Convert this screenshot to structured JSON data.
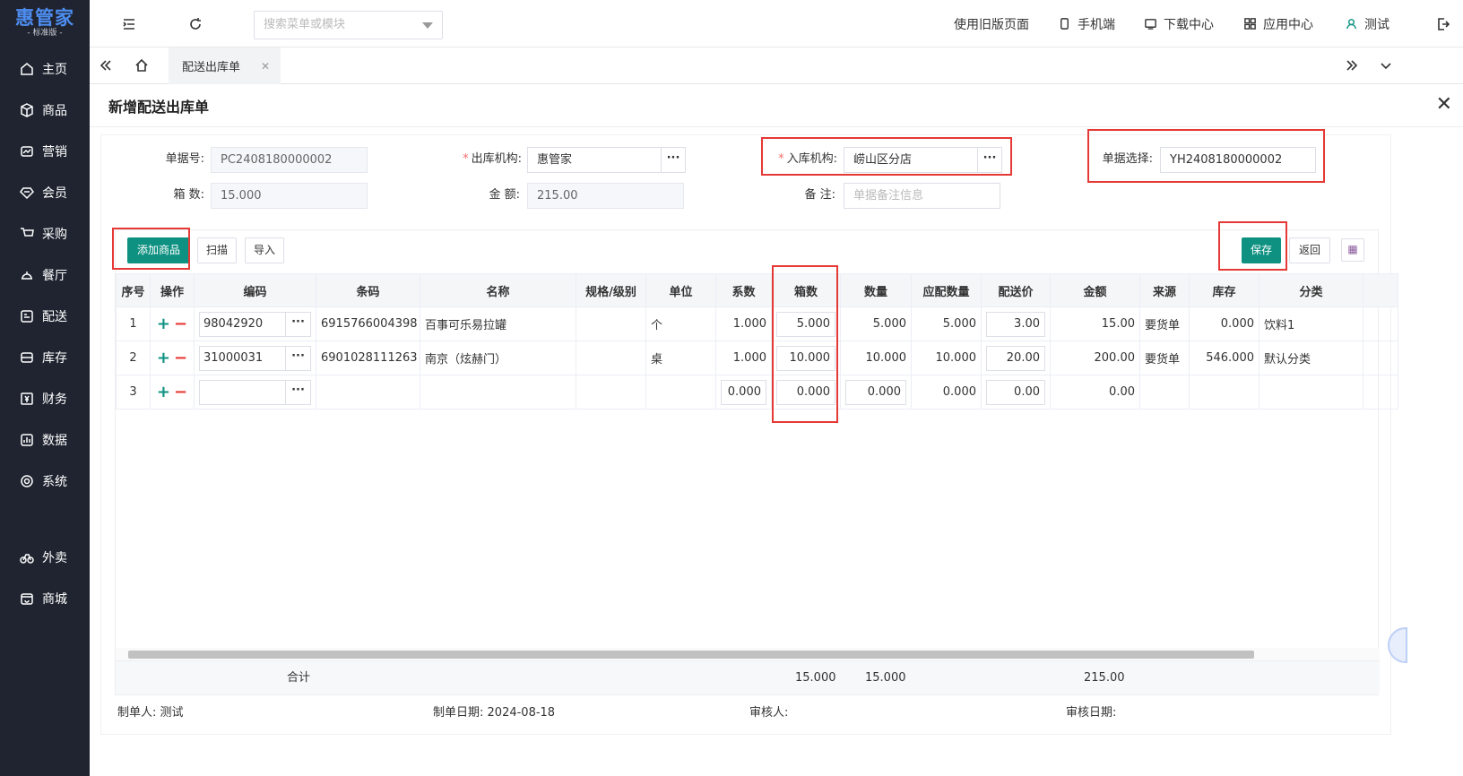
{
  "logo": {
    "brand": "惠管家",
    "edition": "- 标准版 -"
  },
  "nav": [
    {
      "label": "主页",
      "icon": "home-icon"
    },
    {
      "label": "商品",
      "icon": "box-icon"
    },
    {
      "label": "营销",
      "icon": "chart-icon"
    },
    {
      "label": "会员",
      "icon": "diamond-icon"
    },
    {
      "label": "采购",
      "icon": "cart-icon"
    },
    {
      "label": "餐厅",
      "icon": "dish-icon"
    },
    {
      "label": "配送",
      "icon": "delivery-icon"
    },
    {
      "label": "库存",
      "icon": "storage-icon"
    },
    {
      "label": "财务",
      "icon": "finance-icon"
    },
    {
      "label": "数据",
      "icon": "data-icon"
    },
    {
      "label": "系统",
      "icon": "settings-icon"
    },
    {
      "label": "外卖",
      "icon": "bike-icon"
    },
    {
      "label": "商城",
      "icon": "store-icon"
    }
  ],
  "topbar": {
    "search_placeholder": "搜索菜单或模块",
    "old_version": "使用旧版页面",
    "mobile": "手机端",
    "download": "下载中心",
    "apps": "应用中心",
    "user": "测试"
  },
  "tabs": [
    {
      "label": "配送出库单"
    }
  ],
  "panel": {
    "title": "新增配送出库单"
  },
  "form": {
    "doc_no_label": "单据号:",
    "doc_no": "PC2408180000002",
    "out_org_label": "出库机构:",
    "out_org": "惠管家",
    "in_org_label": "入库机构:",
    "in_org": "崂山区分店",
    "doc_select_label": "单据选择:",
    "doc_select": "YH2408180000002",
    "boxes_label": "箱 数:",
    "boxes": "15.000",
    "amount_label": "金 额:",
    "amount": "215.00",
    "remark_label": "备 注:",
    "remark_placeholder": "单据备注信息"
  },
  "toolbar": {
    "add": "添加商品",
    "scan": "扫描",
    "import": "导入",
    "save": "保存",
    "back": "返回"
  },
  "columns": [
    "序号",
    "操作",
    "编码",
    "条码",
    "名称",
    "规格/级别",
    "单位",
    "系数",
    "箱数",
    "数量",
    "应配数量",
    "配送价",
    "金额",
    "来源",
    "库存",
    "分类"
  ],
  "rows": [
    {
      "no": "1",
      "code": "98042920",
      "barcode": "6915766004398",
      "name": "百事可乐易拉罐",
      "spec": "",
      "unit": "个",
      "factor": "1.000",
      "boxes": "5.000",
      "qty": "5.000",
      "need": "5.000",
      "price": "3.00",
      "amount": "15.00",
      "source": "要货单",
      "stock": "0.000",
      "cat": "饮料1"
    },
    {
      "no": "2",
      "code": "31000031",
      "barcode": "6901028111263",
      "name": "南京（炫赫门）",
      "spec": "",
      "unit": "桌",
      "factor": "1.000",
      "boxes": "10.000",
      "qty": "10.000",
      "need": "10.000",
      "price": "20.00",
      "amount": "200.00",
      "source": "要货单",
      "stock": "546.000",
      "cat": "默认分类"
    },
    {
      "no": "3",
      "code": "",
      "barcode": "",
      "name": "",
      "spec": "",
      "unit": "",
      "factor": "0.000",
      "boxes": "0.000",
      "qty": "0.000",
      "need": "0.000",
      "price": "0.00",
      "amount": "0.00",
      "source": "",
      "stock": "",
      "cat": ""
    }
  ],
  "totals": {
    "label": "合计",
    "boxes": "15.000",
    "qty": "15.000",
    "amount": "215.00"
  },
  "footer": {
    "maker_label": "制单人:",
    "maker": "测试",
    "date_label": "制单日期:",
    "date": "2024-08-18",
    "auditor_label": "审核人:",
    "audit_date_label": "审核日期:"
  }
}
